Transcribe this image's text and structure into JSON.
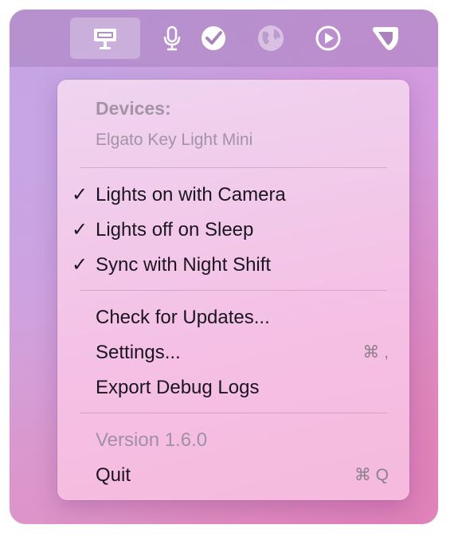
{
  "menu_bar": {
    "icons": [
      "key-light-icon",
      "microphone-icon",
      "checkmark-circle-icon",
      "globe-icon",
      "play-circle-icon",
      "shield-icon"
    ]
  },
  "menu": {
    "devices_header": "Devices:",
    "device_name": "Elgato Key Light Mini",
    "toggles": [
      {
        "label": "Lights on with Camera",
        "checked": true
      },
      {
        "label": "Lights off on Sleep",
        "checked": true
      },
      {
        "label": "Sync with Night Shift",
        "checked": true
      }
    ],
    "check_mark": "✓",
    "actions": {
      "check_updates": "Check for Updates...",
      "settings": "Settings...",
      "settings_shortcut": "⌘ ,",
      "export_logs": "Export Debug Logs"
    },
    "version": "Version 1.6.0",
    "quit": "Quit",
    "quit_shortcut": "⌘ Q"
  }
}
